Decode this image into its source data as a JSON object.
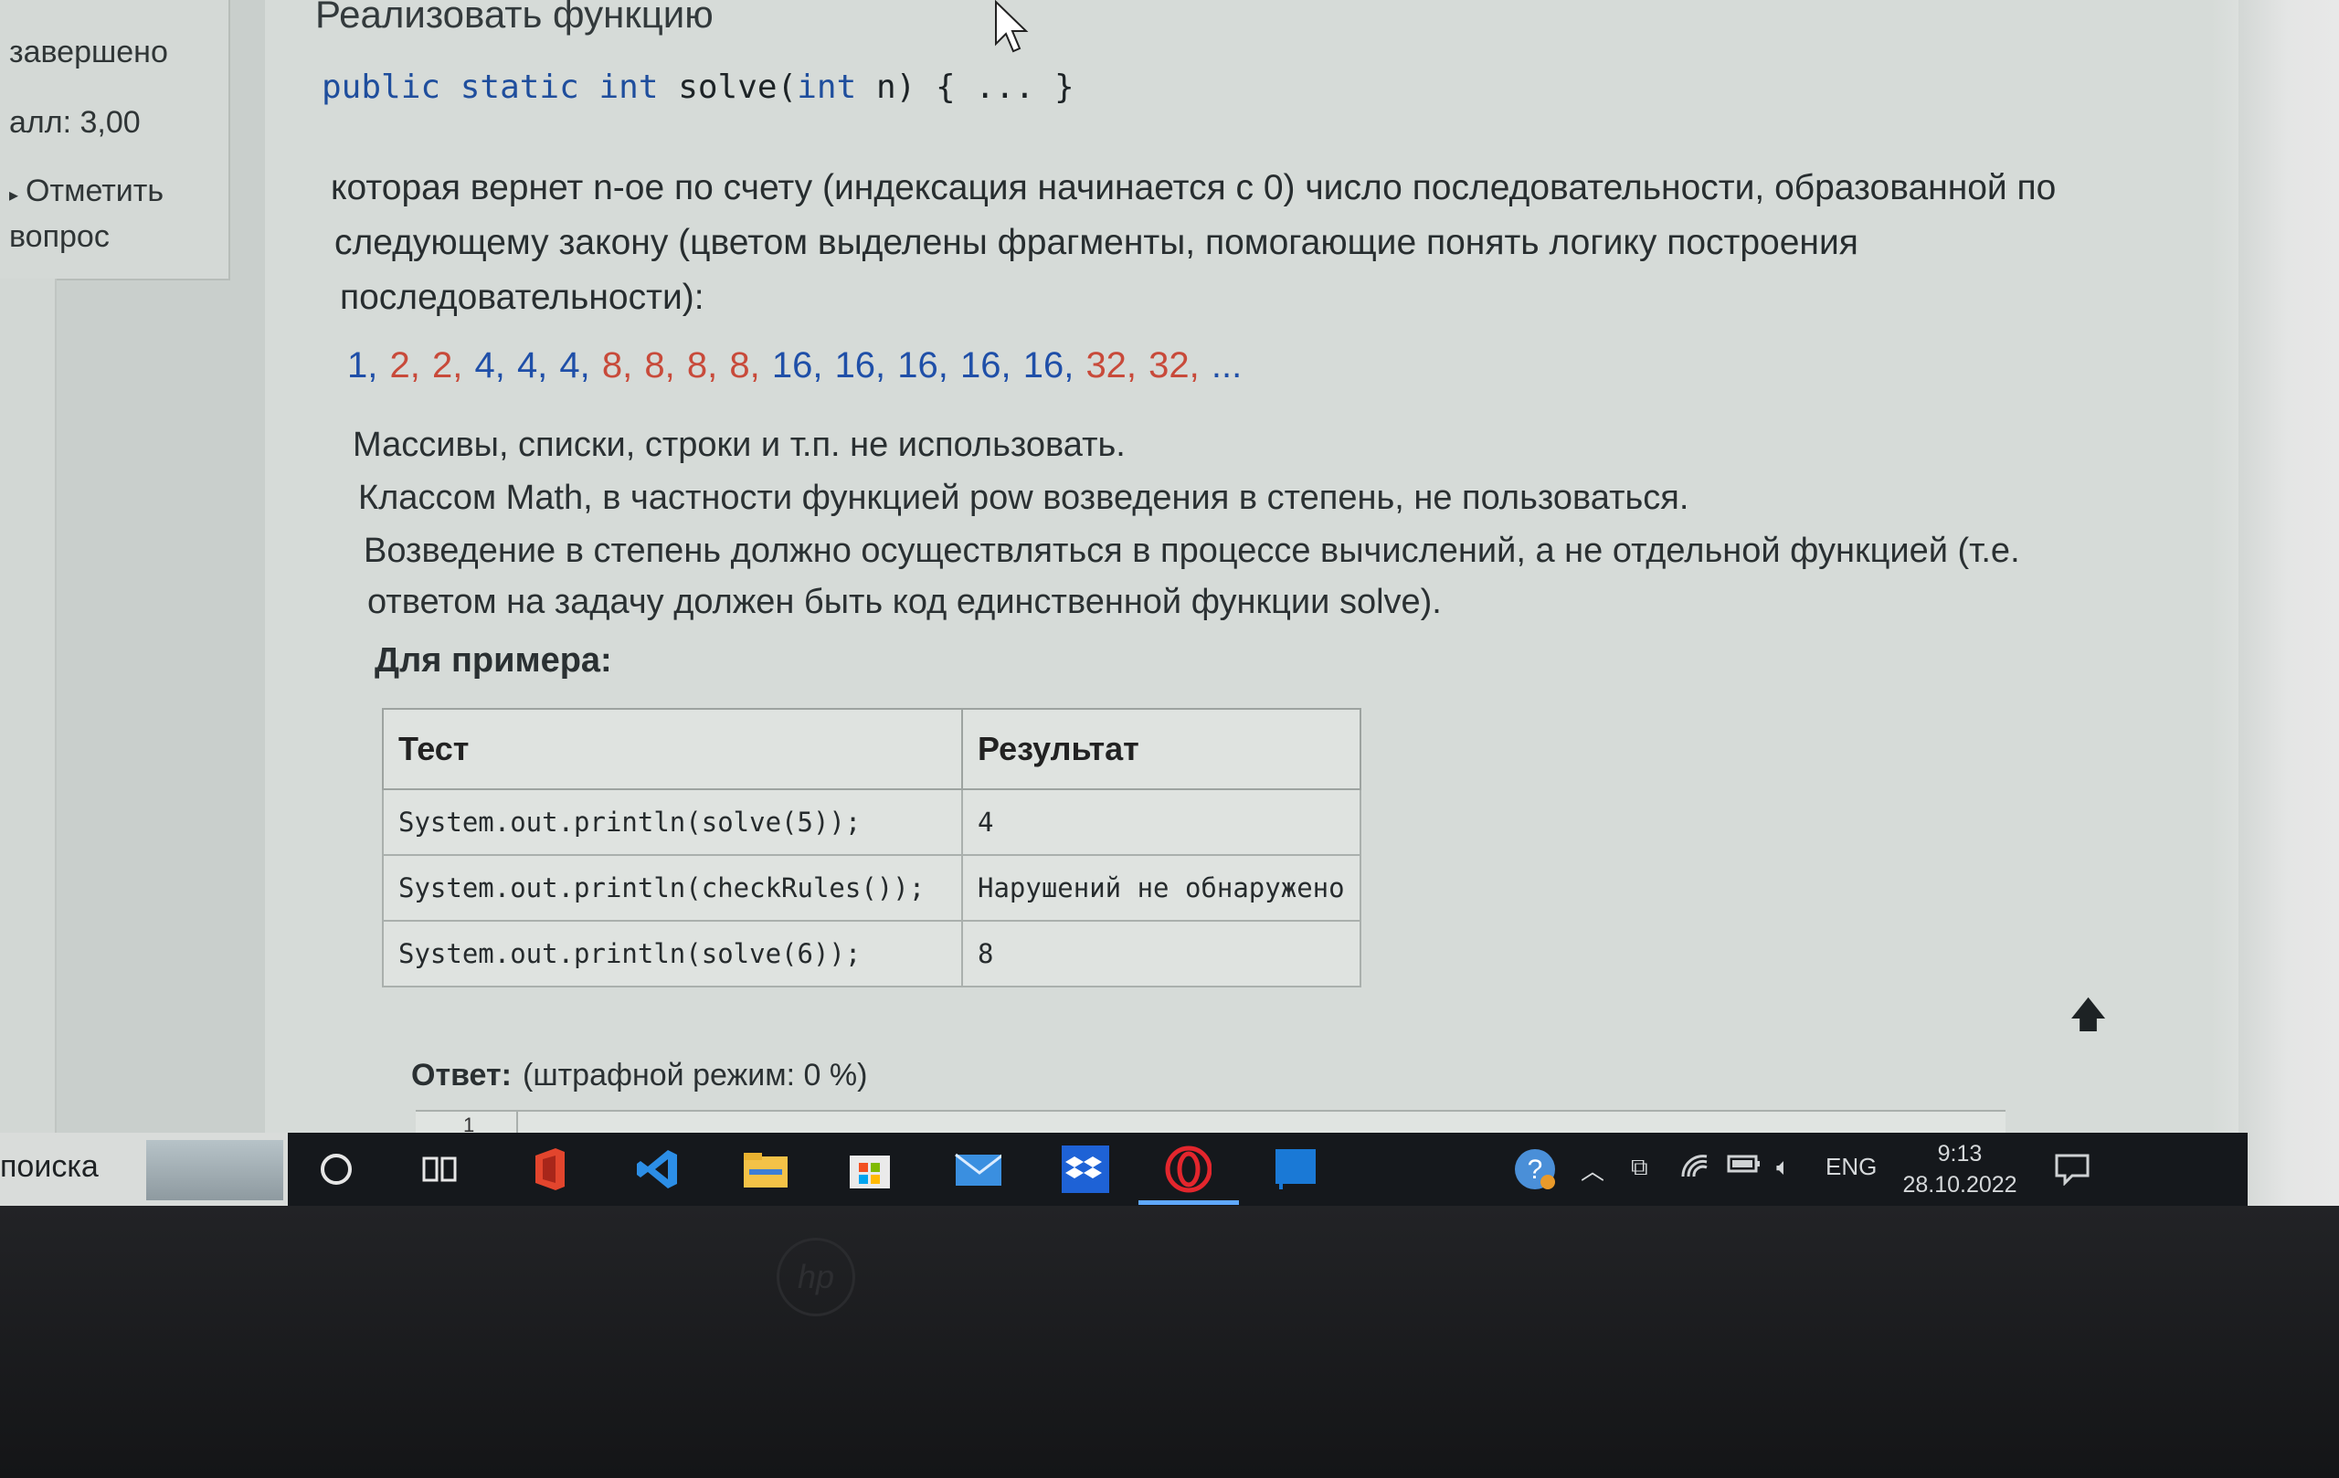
{
  "sidebar": {
    "status": "завершено",
    "score": "алл: 3,00",
    "flag_label": "Отметить",
    "flag_label2": "вопрос"
  },
  "question": {
    "title": "Реализовать функцию",
    "signature": {
      "kw1": "public",
      "kw2": "static",
      "kw3": "int",
      "name": "solve(",
      "kw4": "int",
      "rest": "n) { ... }"
    },
    "description_lines": [
      "которая вернет n-ое по счету (индексация начинается с 0) число последовательности, образованной по",
      "следующему закону (цветом выделены фрагменты, помогающие понять логику построения",
      "последовательности):"
    ],
    "sequence": [
      {
        "text": "1,",
        "color": "#1f4fa8"
      },
      {
        "text": "2,",
        "color": "#c84a3a"
      },
      {
        "text": "2,",
        "color": "#c84a3a"
      },
      {
        "text": "4,",
        "color": "#1f4fa8"
      },
      {
        "text": "4,",
        "color": "#1f4fa8"
      },
      {
        "text": "4,",
        "color": "#1f4fa8"
      },
      {
        "text": "8,",
        "color": "#c84a3a"
      },
      {
        "text": "8,",
        "color": "#c84a3a"
      },
      {
        "text": "8,",
        "color": "#c84a3a"
      },
      {
        "text": "8,",
        "color": "#c84a3a"
      },
      {
        "text": "16,",
        "color": "#1f4fa8"
      },
      {
        "text": "16,",
        "color": "#1f4fa8"
      },
      {
        "text": "16,",
        "color": "#1f4fa8"
      },
      {
        "text": "16,",
        "color": "#1f4fa8"
      },
      {
        "text": "16,",
        "color": "#1f4fa8"
      },
      {
        "text": "32,",
        "color": "#c84a3a"
      },
      {
        "text": "32,",
        "color": "#c84a3a"
      },
      {
        "text": "...",
        "color": "#1f4fa8"
      }
    ],
    "rules": [
      "Массивы, списки, строки и т.п. не использовать.",
      "Классом Math, в частности функцией pow возведения в степень, не пользоваться.",
      "Возведение в степень должно осуществляться в процессе вычислений, а не отдельной функцией (т.е.",
      "ответом на задачу должен быть код единственной функции solve)."
    ],
    "example_heading": "Для примера:",
    "table": {
      "headers": [
        "Тест",
        "Результат"
      ],
      "rows": [
        [
          "System.out.println(solve(5));",
          "4"
        ],
        [
          "System.out.println(checkRules());",
          "Нарушений не обнаружено"
        ],
        [
          "System.out.println(solve(6));",
          "8"
        ]
      ]
    },
    "answer_label": "Ответ:",
    "answer_mode": "(штрафной режим: 0 %)",
    "editor_line_no": "1"
  },
  "taskbar": {
    "search_text": "поиска",
    "lang": "ENG",
    "time": "9:13",
    "date": "28.10.2022"
  },
  "bezel": {
    "logo": "hp"
  }
}
